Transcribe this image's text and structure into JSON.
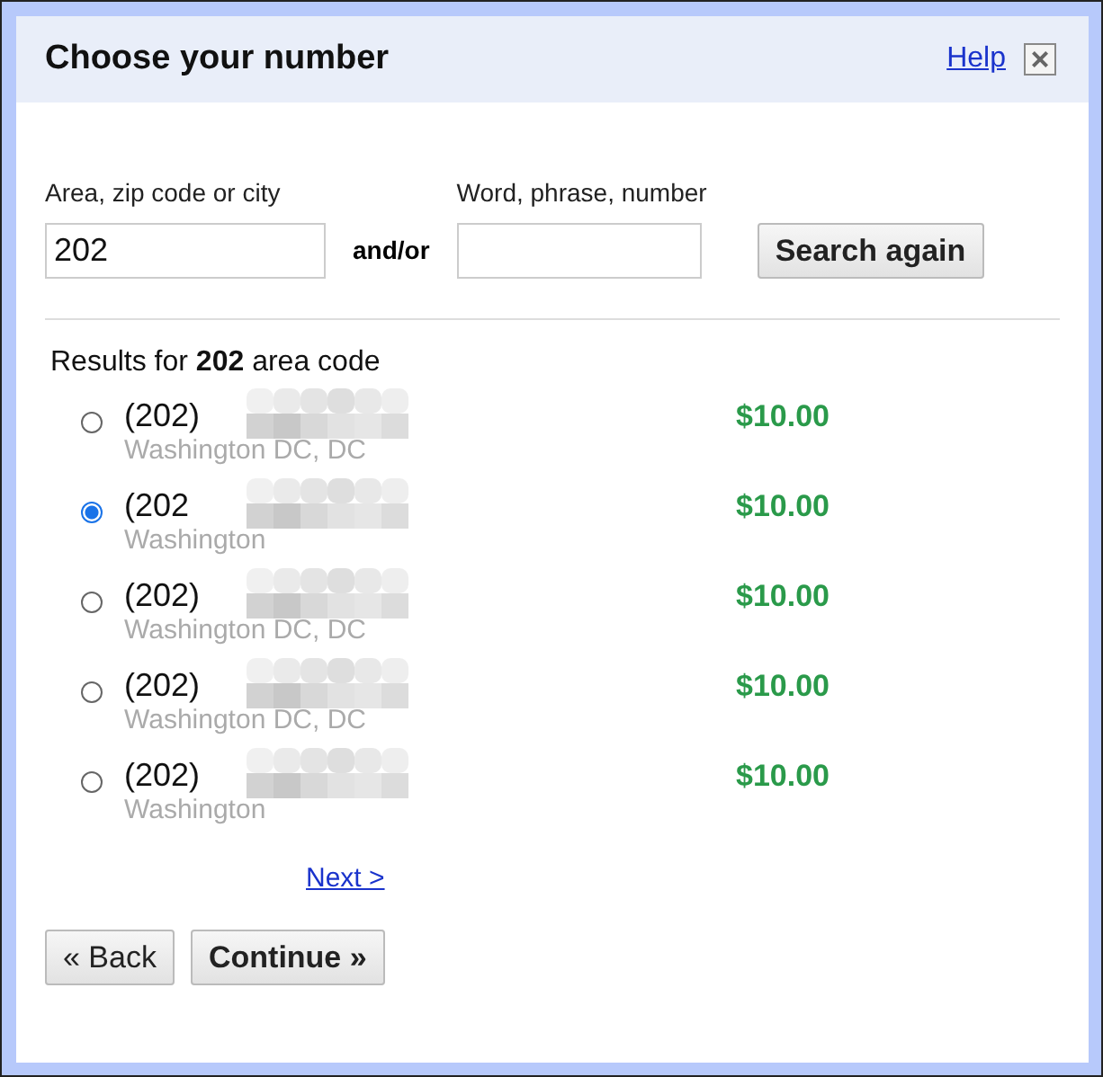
{
  "dialog": {
    "title": "Choose your number",
    "help": "Help",
    "close": "×"
  },
  "search": {
    "area_label": "Area, zip code or city",
    "area_value": "202",
    "joiner": "and/or",
    "word_label": "Word, phrase, number",
    "button": "Search again"
  },
  "results": {
    "heading": "Results for **202** area code",
    "items": [
      {
        "number": "(202)",
        "location": "Washington DC, DC",
        "price": "$10.00",
        "selected": false
      },
      {
        "number": "(202",
        "location": "Washington",
        "price": "$10.00",
        "selected": true
      },
      {
        "number": "(202)",
        "location": "Washington DC, DC",
        "price": "$10.00",
        "selected": false
      },
      {
        "number": "(202)",
        "location": "Washington DC, DC",
        "price": "$10.00",
        "selected": false
      },
      {
        "number": "(202)",
        "location": "Washington",
        "price": "$10.00",
        "selected": false
      }
    ],
    "next": "Next >"
  },
  "buttons": [
    {
      "label": "« Back",
      "kind": "plain"
    },
    {
      "label": "Continue »",
      "kind": "primary"
    }
  ]
}
